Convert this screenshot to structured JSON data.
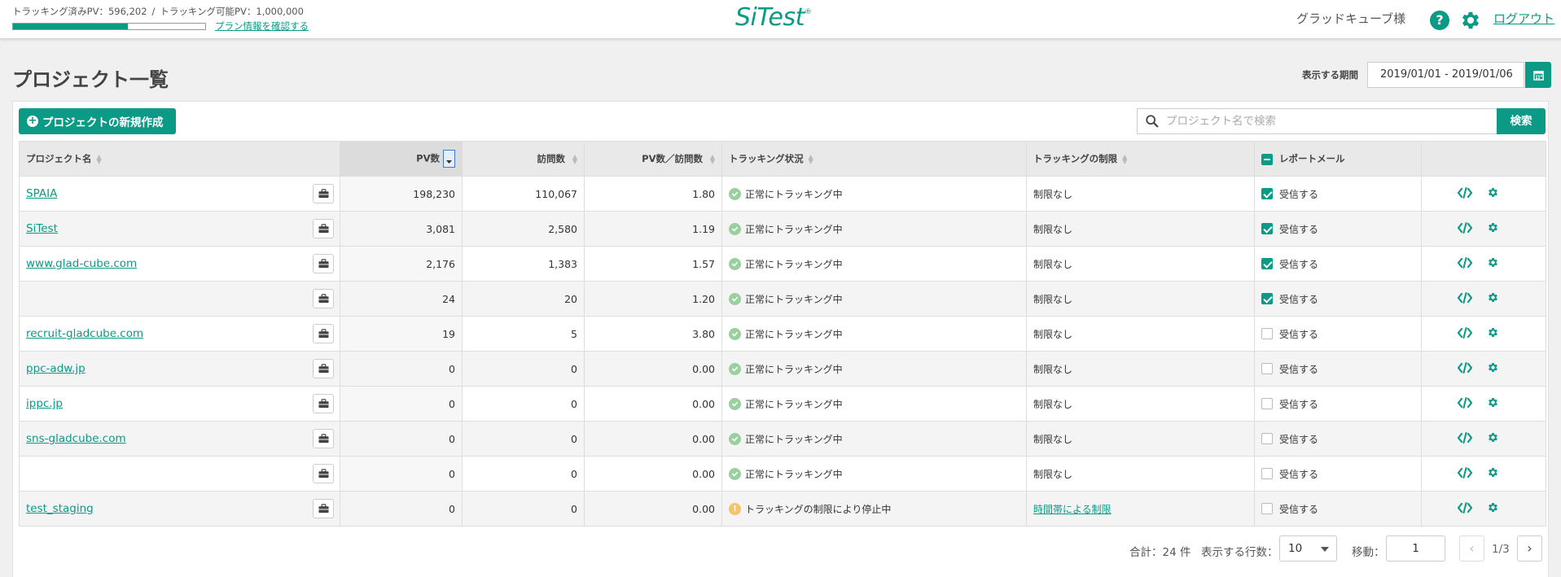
{
  "header": {
    "tracked_pv_label": "トラッキング済みPV：",
    "tracked_pv_value": "596,202",
    "separator": "/",
    "trackable_pv_label": "トラッキング可能PV：",
    "trackable_pv_value": "1,000,000",
    "usage_fraction": 0.596,
    "plan_link": "プラン情報を確認する",
    "logo": "SiTest",
    "logo_mark": "®",
    "user_name": "グラッドキューブ様",
    "help_symbol": "?",
    "logout": "ログアウト",
    "icons": [
      "help-icon",
      "gear-icon"
    ]
  },
  "page": {
    "title": "プロジェクト一覧",
    "period_label": "表示する期間",
    "period_value": "2019/01/01 - 2019/01/06"
  },
  "toolbar": {
    "new_project": "プロジェクトの新規作成",
    "search_placeholder": "プロジェクト名で検索",
    "search_button": "検索"
  },
  "table": {
    "columns": {
      "name": "プロジェクト名",
      "pv": "PV数",
      "visits": "訪問数",
      "pv_per_visit": "PV数／訪問数",
      "status": "トラッキング状況",
      "limit": "トラッキングの制限",
      "report_mail": "レポートメール"
    },
    "rows": [
      {
        "name": "SPAIA",
        "pv": "198,230",
        "visits": "110,067",
        "ratio": "1.80",
        "status": "正常にトラッキング中",
        "status_type": "ok",
        "limit": "制限なし",
        "limit_link": false,
        "mail_checked": true,
        "mail_label": "受信する"
      },
      {
        "name": "SiTest",
        "pv": "3,081",
        "visits": "2,580",
        "ratio": "1.19",
        "status": "正常にトラッキング中",
        "status_type": "ok",
        "limit": "制限なし",
        "limit_link": false,
        "mail_checked": true,
        "mail_label": "受信する"
      },
      {
        "name": "www.glad-cube.com",
        "pv": "2,176",
        "visits": "1,383",
        "ratio": "1.57",
        "status": "正常にトラッキング中",
        "status_type": "ok",
        "limit": "制限なし",
        "limit_link": false,
        "mail_checked": true,
        "mail_label": "受信する"
      },
      {
        "name": "",
        "pv": "24",
        "visits": "20",
        "ratio": "1.20",
        "status": "正常にトラッキング中",
        "status_type": "ok",
        "limit": "制限なし",
        "limit_link": false,
        "mail_checked": true,
        "mail_label": "受信する"
      },
      {
        "name": "recruit-gladcube.com",
        "pv": "19",
        "visits": "5",
        "ratio": "3.80",
        "status": "正常にトラッキング中",
        "status_type": "ok",
        "limit": "制限なし",
        "limit_link": false,
        "mail_checked": false,
        "mail_label": "受信する"
      },
      {
        "name": "ppc-adw.jp",
        "pv": "0",
        "visits": "0",
        "ratio": "0.00",
        "status": "正常にトラッキング中",
        "status_type": "ok",
        "limit": "制限なし",
        "limit_link": false,
        "mail_checked": false,
        "mail_label": "受信する"
      },
      {
        "name": "ippc.jp",
        "pv": "0",
        "visits": "0",
        "ratio": "0.00",
        "status": "正常にトラッキング中",
        "status_type": "ok",
        "limit": "制限なし",
        "limit_link": false,
        "mail_checked": false,
        "mail_label": "受信する"
      },
      {
        "name": "sns-gladcube.com",
        "pv": "0",
        "visits": "0",
        "ratio": "0.00",
        "status": "正常にトラッキング中",
        "status_type": "ok",
        "limit": "制限なし",
        "limit_link": false,
        "mail_checked": false,
        "mail_label": "受信する"
      },
      {
        "name": "",
        "pv": "0",
        "visits": "0",
        "ratio": "0.00",
        "status": "正常にトラッキング中",
        "status_type": "ok",
        "limit": "制限なし",
        "limit_link": false,
        "mail_checked": false,
        "mail_label": "受信する"
      },
      {
        "name": "test_staging",
        "pv": "0",
        "visits": "0",
        "ratio": "0.00",
        "status": "トラッキングの制限により停止中",
        "status_type": "warn",
        "limit": "時間帯による制限",
        "limit_link": true,
        "mail_checked": false,
        "mail_label": "受信する"
      }
    ],
    "row_icons": [
      "briefcase-icon",
      "code-icon",
      "gear-icon"
    ]
  },
  "pagination": {
    "total": "合計：24 件",
    "rows_label": "表示する行数：",
    "rows_value": "10",
    "move_label": "移動：",
    "move_value": "1",
    "page_indicator": "1/3",
    "prev": "‹",
    "next": "›"
  },
  "colors": {
    "accent": "#0a9a86",
    "ok": "#9ad0a0",
    "warn": "#f5c36b"
  }
}
